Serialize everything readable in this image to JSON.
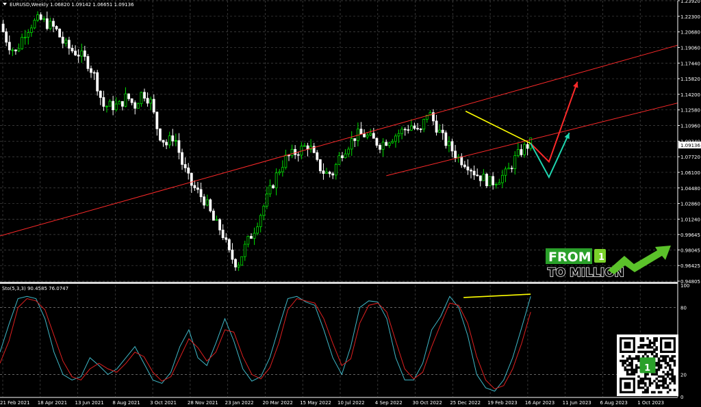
{
  "chart_data": [
    {
      "type": "candlestick",
      "title": "EURUSD,Weekly 1.06820 1.09142 1.06651 1.09136",
      "ylim": [
        0.94805,
        1.2392
      ],
      "y_ticks": [
        "1.23920",
        "1.22300",
        "1.20680",
        "1.19060",
        "1.17440",
        "1.15820",
        "1.14200",
        "1.12580",
        "1.10960",
        "1.09340",
        "1.07720",
        "1.06100",
        "1.04480",
        "1.02860",
        "1.01240",
        "0.99645",
        "0.98045",
        "0.96425",
        "0.94805"
      ],
      "x_ticks": [
        "21 Feb 2021",
        "18 Apr 2021",
        "13 Jun 2021",
        "8 Aug 2021",
        "3 Oct 2021",
        "28 Nov 2021",
        "23 Jan 2022",
        "20 Mar 2022",
        "15 May 2022",
        "10 Jul 2022",
        "4 Sep 2022",
        "30 Oct 2022",
        "25 Dec 2022",
        "19 Feb 2023",
        "16 Apr 2023",
        "11 Jun 2023",
        "6 Aug 2023",
        "1 Oct 2023"
      ],
      "current_price": "1.09136",
      "close_path": [
        1.215,
        1.195,
        1.185,
        1.205,
        1.215,
        1.22,
        1.215,
        1.21,
        1.195,
        1.188,
        1.184,
        1.176,
        1.16,
        1.13,
        1.13,
        1.13,
        1.14,
        1.13,
        1.145,
        1.135,
        1.102,
        1.09,
        1.1,
        1.07,
        1.05,
        1.04,
        1.03,
        1.01,
        1.0,
        0.975,
        0.965,
        0.985,
        1.0,
        1.02,
        1.04,
        1.06,
        1.075,
        1.08,
        1.085,
        1.09,
        1.07,
        1.06,
        1.06,
        1.08,
        1.09,
        1.1,
        1.1,
        1.095,
        1.09,
        1.095,
        1.1,
        1.105,
        1.11,
        1.1,
        1.125,
        1.11,
        1.095,
        1.085,
        1.075,
        1.07,
        1.06,
        1.055,
        1.05,
        1.055,
        1.06,
        1.075,
        1.085,
        1.09136
      ],
      "trend_lines": [
        {
          "color": "#ff2a2a",
          "from": [
            0,
            0.995
          ],
          "to": [
            1,
            1.193
          ]
        },
        {
          "color": "#ff2a2a",
          "from": [
            0.57,
            1.0575
          ],
          "to": [
            1,
            1.133
          ]
        },
        {
          "color": "#ffff00",
          "from": [
            0.687,
            1.1245
          ],
          "to": [
            0.783,
            1.091
          ]
        }
      ],
      "projections": [
        {
          "color": "#ff2a2a",
          "points": [
            [
              0.783,
              1.091
            ],
            [
              0.81,
              1.072
            ],
            [
              0.852,
              1.155
            ]
          ]
        },
        {
          "color": "#1fd6b0",
          "points": [
            [
              0.783,
              1.091
            ],
            [
              0.81,
              1.056
            ],
            [
              0.84,
              1.102
            ]
          ]
        }
      ]
    },
    {
      "type": "line",
      "title": "Sto(5,3,3) 90.4585 76.0747",
      "ylim": [
        0,
        100
      ],
      "y_ticks": [
        "100",
        "80",
        "20",
        "0"
      ],
      "levels": [
        80,
        20
      ],
      "series": [
        {
          "color": "#3fb8c8",
          "values": [
            40,
            65,
            88,
            90,
            88,
            70,
            40,
            20,
            15,
            18,
            35,
            28,
            20,
            25,
            35,
            45,
            30,
            15,
            12,
            22,
            45,
            60,
            35,
            28,
            48,
            70,
            50,
            25,
            14,
            18,
            35,
            62,
            88,
            90,
            85,
            82,
            60,
            35,
            20,
            45,
            80,
            86,
            85,
            70,
            35,
            15,
            15,
            30,
            60,
            72,
            90,
            80,
            55,
            20,
            8,
            5,
            15,
            35,
            62,
            90
          ]
        },
        {
          "color": "#e02020",
          "values": [
            30,
            50,
            80,
            88,
            86,
            78,
            55,
            32,
            18,
            15,
            25,
            30,
            25,
            22,
            30,
            40,
            36,
            22,
            14,
            18,
            35,
            52,
            44,
            32,
            40,
            60,
            58,
            36,
            20,
            16,
            26,
            48,
            78,
            88,
            86,
            84,
            70,
            48,
            28,
            34,
            66,
            82,
            84,
            76,
            50,
            25,
            16,
            22,
            45,
            65,
            84,
            82,
            66,
            36,
            15,
            7,
            10,
            25,
            48,
            76
          ]
        }
      ],
      "divergence_line": {
        "color": "#ffff00",
        "from": [
          0.684,
          89
        ],
        "to": [
          0.783,
          92
        ]
      }
    }
  ],
  "logo": {
    "text_from": "FROM",
    "text_to_million": "TO MILLION",
    "badge_digit": "1",
    "colors": {
      "green": "#2aa02a",
      "light_green": "#7ad12a"
    }
  },
  "qr": {
    "present": true,
    "badge_digit": "1"
  },
  "colors": {
    "background": "#000000",
    "grid": "#4a4a4a",
    "up_candle": "#00e000",
    "down_candle": "#ffffff",
    "axis_text": "#ffffff"
  }
}
